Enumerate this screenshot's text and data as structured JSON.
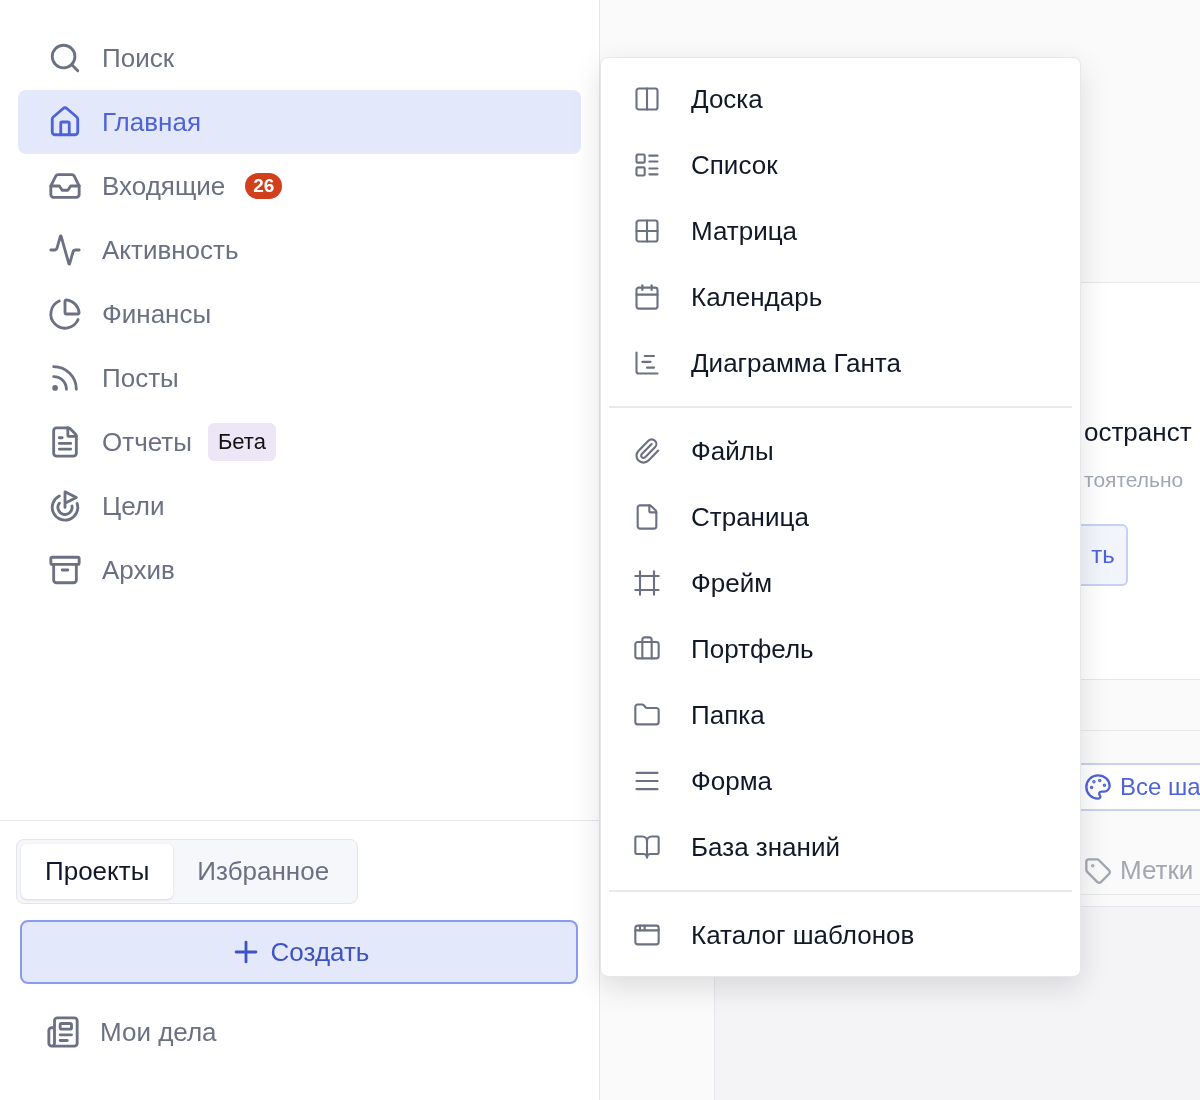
{
  "sidebar": {
    "nav_items": [
      {
        "label": "Поиск",
        "selected": false
      },
      {
        "label": "Главная",
        "selected": true
      },
      {
        "label": "Входящие",
        "selected": false,
        "badge": {
          "text": "26",
          "kind": "count"
        }
      },
      {
        "label": "Активность",
        "selected": false
      },
      {
        "label": "Финансы",
        "selected": false
      },
      {
        "label": "Посты",
        "selected": false
      },
      {
        "label": "Отчеты",
        "selected": false,
        "badge": {
          "text": "Бета",
          "kind": "tag"
        }
      },
      {
        "label": "Цели",
        "selected": false
      },
      {
        "label": "Архив",
        "selected": false
      }
    ],
    "tabs": [
      {
        "label": "Проекты",
        "selected": true
      },
      {
        "label": "Избранное",
        "selected": false
      }
    ],
    "create_button": {
      "label": "Создать"
    },
    "bottom_items": [
      {
        "label": "Мои дела"
      }
    ]
  },
  "menu": {
    "sections": [
      {
        "items": [
          "Доска",
          "Список",
          "Матрица",
          "Календарь",
          "Диаграмма Ганта"
        ]
      },
      {
        "items": [
          "Файлы",
          "Страница",
          "Фрейм",
          "Портфель",
          "Папка",
          "Форма",
          "База знаний"
        ]
      },
      {
        "items": [
          "Каталог шаблонов"
        ]
      }
    ]
  },
  "background": {
    "card_title": "остранст",
    "card_text": "тоятельно",
    "card_button": "ть",
    "templates_button": "Все ша",
    "tags_label": "Метки"
  }
}
